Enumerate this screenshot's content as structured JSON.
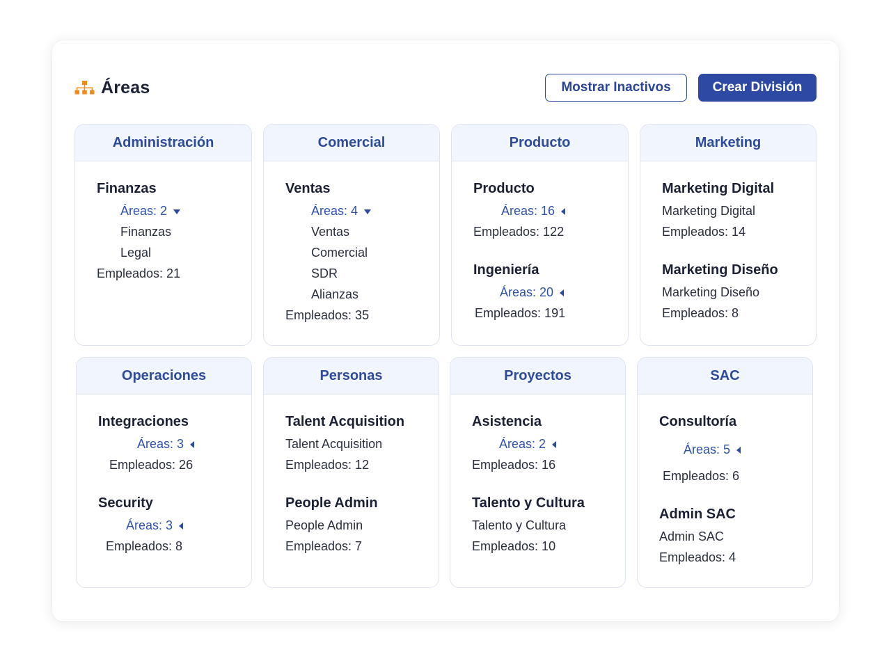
{
  "header": {
    "title": "Áreas",
    "icon": "org-chart-icon",
    "accent_color": "#f08a1c"
  },
  "actions": {
    "show_inactive_label": "Mostrar Inactivos",
    "create_division_label": "Crear División"
  },
  "divisions": [
    {
      "name": "Administración",
      "groups": [
        {
          "title": "Finanzas",
          "areas_label": "Áreas: 2",
          "expanded": true,
          "areas": [
            "Finanzas",
            "Legal"
          ],
          "employees": "Empleados: 21"
        }
      ]
    },
    {
      "name": "Comercial",
      "groups": [
        {
          "title": "Ventas",
          "areas_label": "Áreas: 4",
          "expanded": true,
          "areas": [
            "Ventas",
            "Comercial",
            "SDR",
            "Alianzas"
          ],
          "employees": "Empleados: 35"
        }
      ]
    },
    {
      "name": "Producto",
      "groups": [
        {
          "title": "Producto",
          "areas_label": "Áreas: 16",
          "expanded": false,
          "employees": "Empleados: 122"
        },
        {
          "title": "Ingeniería",
          "areas_label": "Áreas: 20",
          "expanded": false,
          "employees": "Empleados: 191"
        }
      ]
    },
    {
      "name": "Marketing",
      "groups": [
        {
          "title": "Marketing Digital",
          "subtitle": "Marketing Digital",
          "employees": "Empleados: 14"
        },
        {
          "title": "Marketing Diseño",
          "subtitle": "Marketing Diseño",
          "employees": "Empleados: 8"
        }
      ]
    },
    {
      "name": "Operaciones",
      "groups": [
        {
          "title": "Integraciones",
          "areas_label": "Áreas: 3",
          "expanded": false,
          "employees": "Empleados: 26"
        },
        {
          "title": "Security",
          "areas_label": "Áreas: 3",
          "expanded": false,
          "employees": "Empleados: 8"
        }
      ]
    },
    {
      "name": "Personas",
      "groups": [
        {
          "title": "Talent Acquisition",
          "subtitle": "Talent Acquisition",
          "employees": "Empleados: 12"
        },
        {
          "title": "People Admin",
          "subtitle": "People Admin",
          "employees": "Empleados: 7"
        }
      ]
    },
    {
      "name": "Proyectos",
      "groups": [
        {
          "title": "Asistencia",
          "areas_label": "Áreas: 2",
          "expanded": false,
          "employees": "Empleados: 16"
        },
        {
          "title": "Talento y Cultura",
          "subtitle": "Talento y Cultura",
          "employees": "Empleados: 10"
        }
      ]
    },
    {
      "name": "SAC",
      "groups": [
        {
          "title": "Consultoría",
          "areas_label": "Áreas: 5",
          "expanded": false,
          "employees": "Empleados: 6"
        },
        {
          "title": "Admin SAC",
          "subtitle": "Admin SAC",
          "employees": "Empleados: 4"
        }
      ]
    }
  ]
}
